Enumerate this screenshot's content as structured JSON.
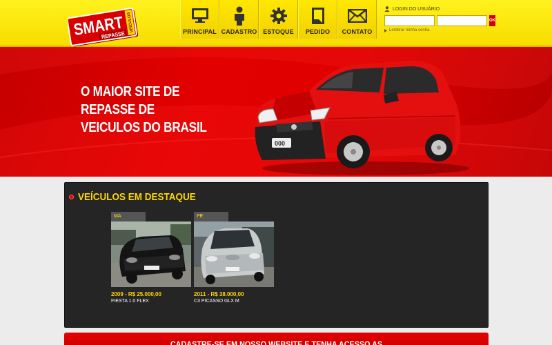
{
  "logo": {
    "word": "SMART",
    "tag": "REPASSE",
    "side": "VEÍCULOS"
  },
  "nav": {
    "items": [
      {
        "label": "PRINCIPAL",
        "icon": "monitor-icon"
      },
      {
        "label": "CADASTRO",
        "icon": "user-icon"
      },
      {
        "label": "ESTOQUE",
        "icon": "gear-icon"
      },
      {
        "label": "PEDIDO",
        "icon": "document-icon"
      },
      {
        "label": "CONTATO",
        "icon": "envelope-icon"
      }
    ]
  },
  "login": {
    "title": "LOGIN DO USUÁRIO",
    "user_value": "",
    "password_value": "",
    "button_label": "OK",
    "forgot_label": "Lembrar minha senha."
  },
  "hero": {
    "headline": "O MAIOR SITE DE REPASSE DE VEICULOS DO BRASIL",
    "car_plate": "000"
  },
  "featured": {
    "title": "VEÍCULOS EM DESTAQUE",
    "cards": [
      {
        "state": "MA",
        "price": "2009 - R$ 25.000,00",
        "model": "FIESTA 1.0 FLEX"
      },
      {
        "state": "PE",
        "price": "2011 - R$ 38.000,00",
        "model": "C3 PICASSO GLX M"
      }
    ]
  },
  "cta": {
    "text": "CADASTRE-SE EM NOSSO WEBSITE E TENHA ACESSO AS"
  },
  "colors": {
    "yellow": "#ffe800",
    "red": "#e00000",
    "dark_panel": "#252525",
    "gold_text": "#ffd800"
  }
}
